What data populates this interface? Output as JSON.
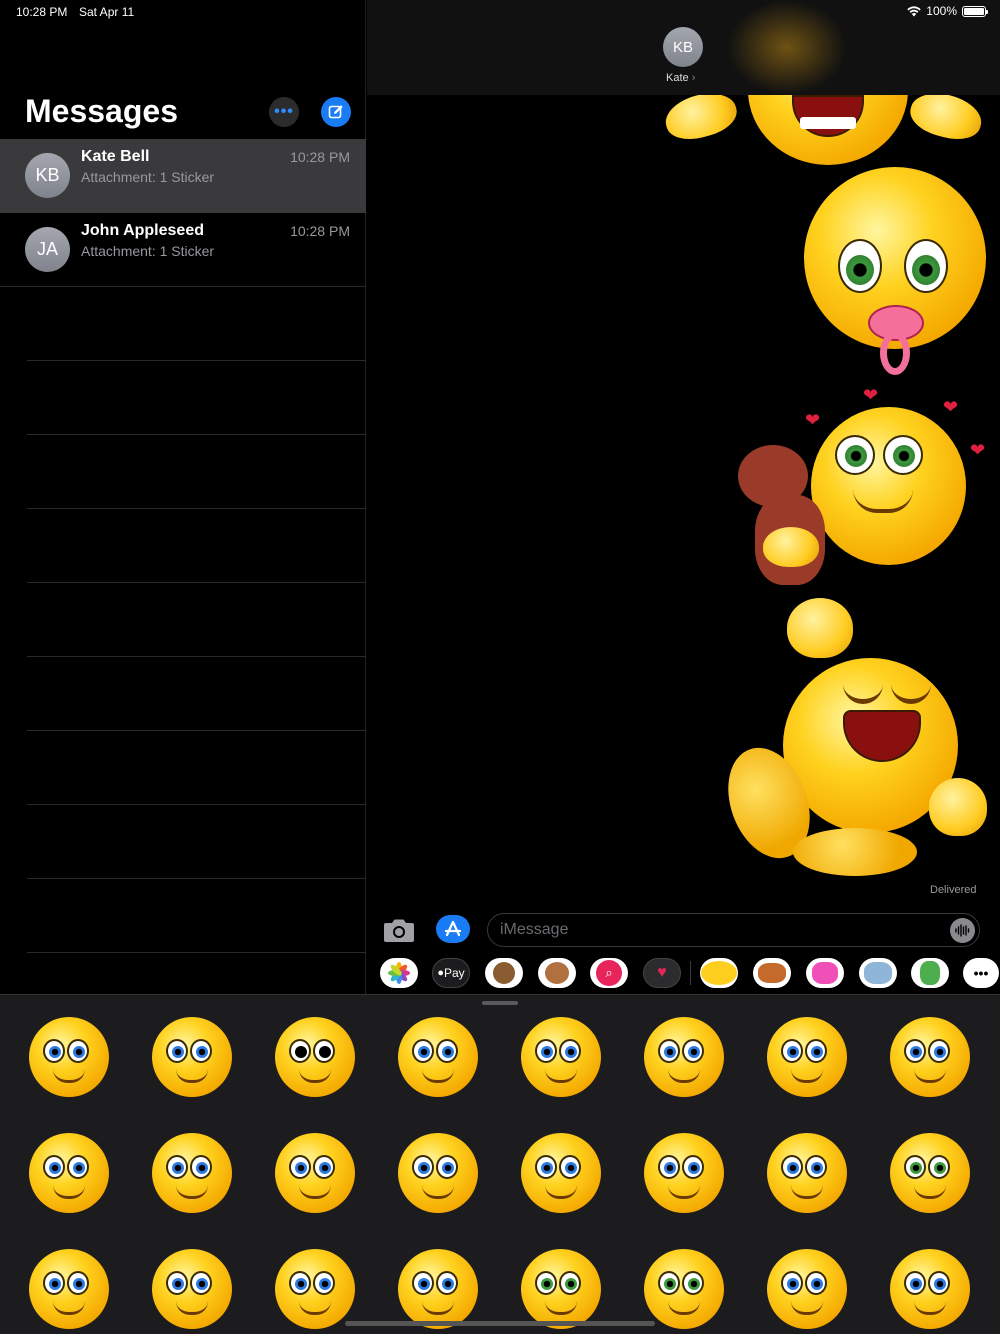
{
  "status_bar": {
    "time": "10:28 PM",
    "date": "Sat Apr 11",
    "battery": "100%"
  },
  "sidebar": {
    "title": "Messages",
    "conversations": [
      {
        "initials": "KB",
        "name": "Kate Bell",
        "preview": "Attachment: 1 Sticker",
        "time": "10:28 PM",
        "selected": true
      },
      {
        "initials": "JA",
        "name": "John Appleseed",
        "preview": "Attachment: 1 Sticker",
        "time": "10:28 PM",
        "selected": false
      }
    ]
  },
  "chat": {
    "contact_initials": "KB",
    "contact_name": "Kate",
    "status": "Delivered",
    "input_placeholder": "iMessage",
    "stickers": [
      "screaming-face-sticker",
      "baby-pacifier-face-sticker",
      "teddy-bear-love-face-sticker",
      "laughing-rolling-face-sticker"
    ]
  },
  "app_strip": {
    "apps": [
      "photos",
      "apple-pay",
      "monkey-memoji",
      "memoji",
      "search-images",
      "heart-stickers",
      "emoji-stickers",
      "dog-stickers",
      "cat-stickers",
      "elephant-stickers",
      "fairy-stickers",
      "more"
    ],
    "apple_pay_label": "Pay"
  },
  "sticker_drawer": {
    "items": [
      "toilet-laughing",
      "kissing-hearts",
      "skull-thumbs-up",
      "bubble-gum",
      "bomb-smile",
      "screaming-hands",
      "shy-thinking",
      "astronaut",
      "laughing-arms",
      "dancing-happy",
      "blue-eyes-smile",
      "superhero",
      "tired-hanging",
      "covering-face",
      "kiss-marks",
      "baby-pacifier",
      "magnifier-detective",
      "rose-gift",
      "hands-on-mouth",
      "angel",
      "waving-hello",
      "teddy-bear",
      "hands-on-ears",
      "blowing-kiss"
    ]
  }
}
